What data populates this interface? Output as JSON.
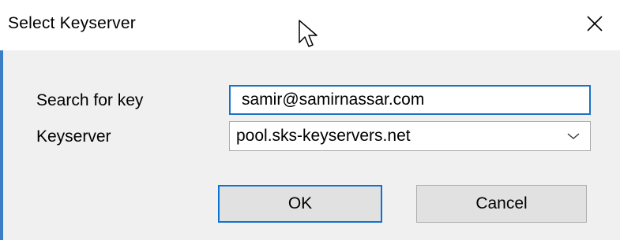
{
  "window": {
    "title": "Select Keyserver",
    "close_icon": "close-icon",
    "accent_color": "#3a7fc5"
  },
  "form": {
    "search_label": "Search for key",
    "search_value": "samir@samirnassar.com",
    "keyserver_label": "Keyserver",
    "keyserver_selected": "pool.sks-keyservers.net",
    "dropdown_icon": "chevron-down-icon"
  },
  "buttons": {
    "ok_label": "OK",
    "cancel_label": "Cancel",
    "default_border_color": "#0c73d6"
  },
  "cursor": {
    "icon": "mouse-pointer-icon"
  }
}
